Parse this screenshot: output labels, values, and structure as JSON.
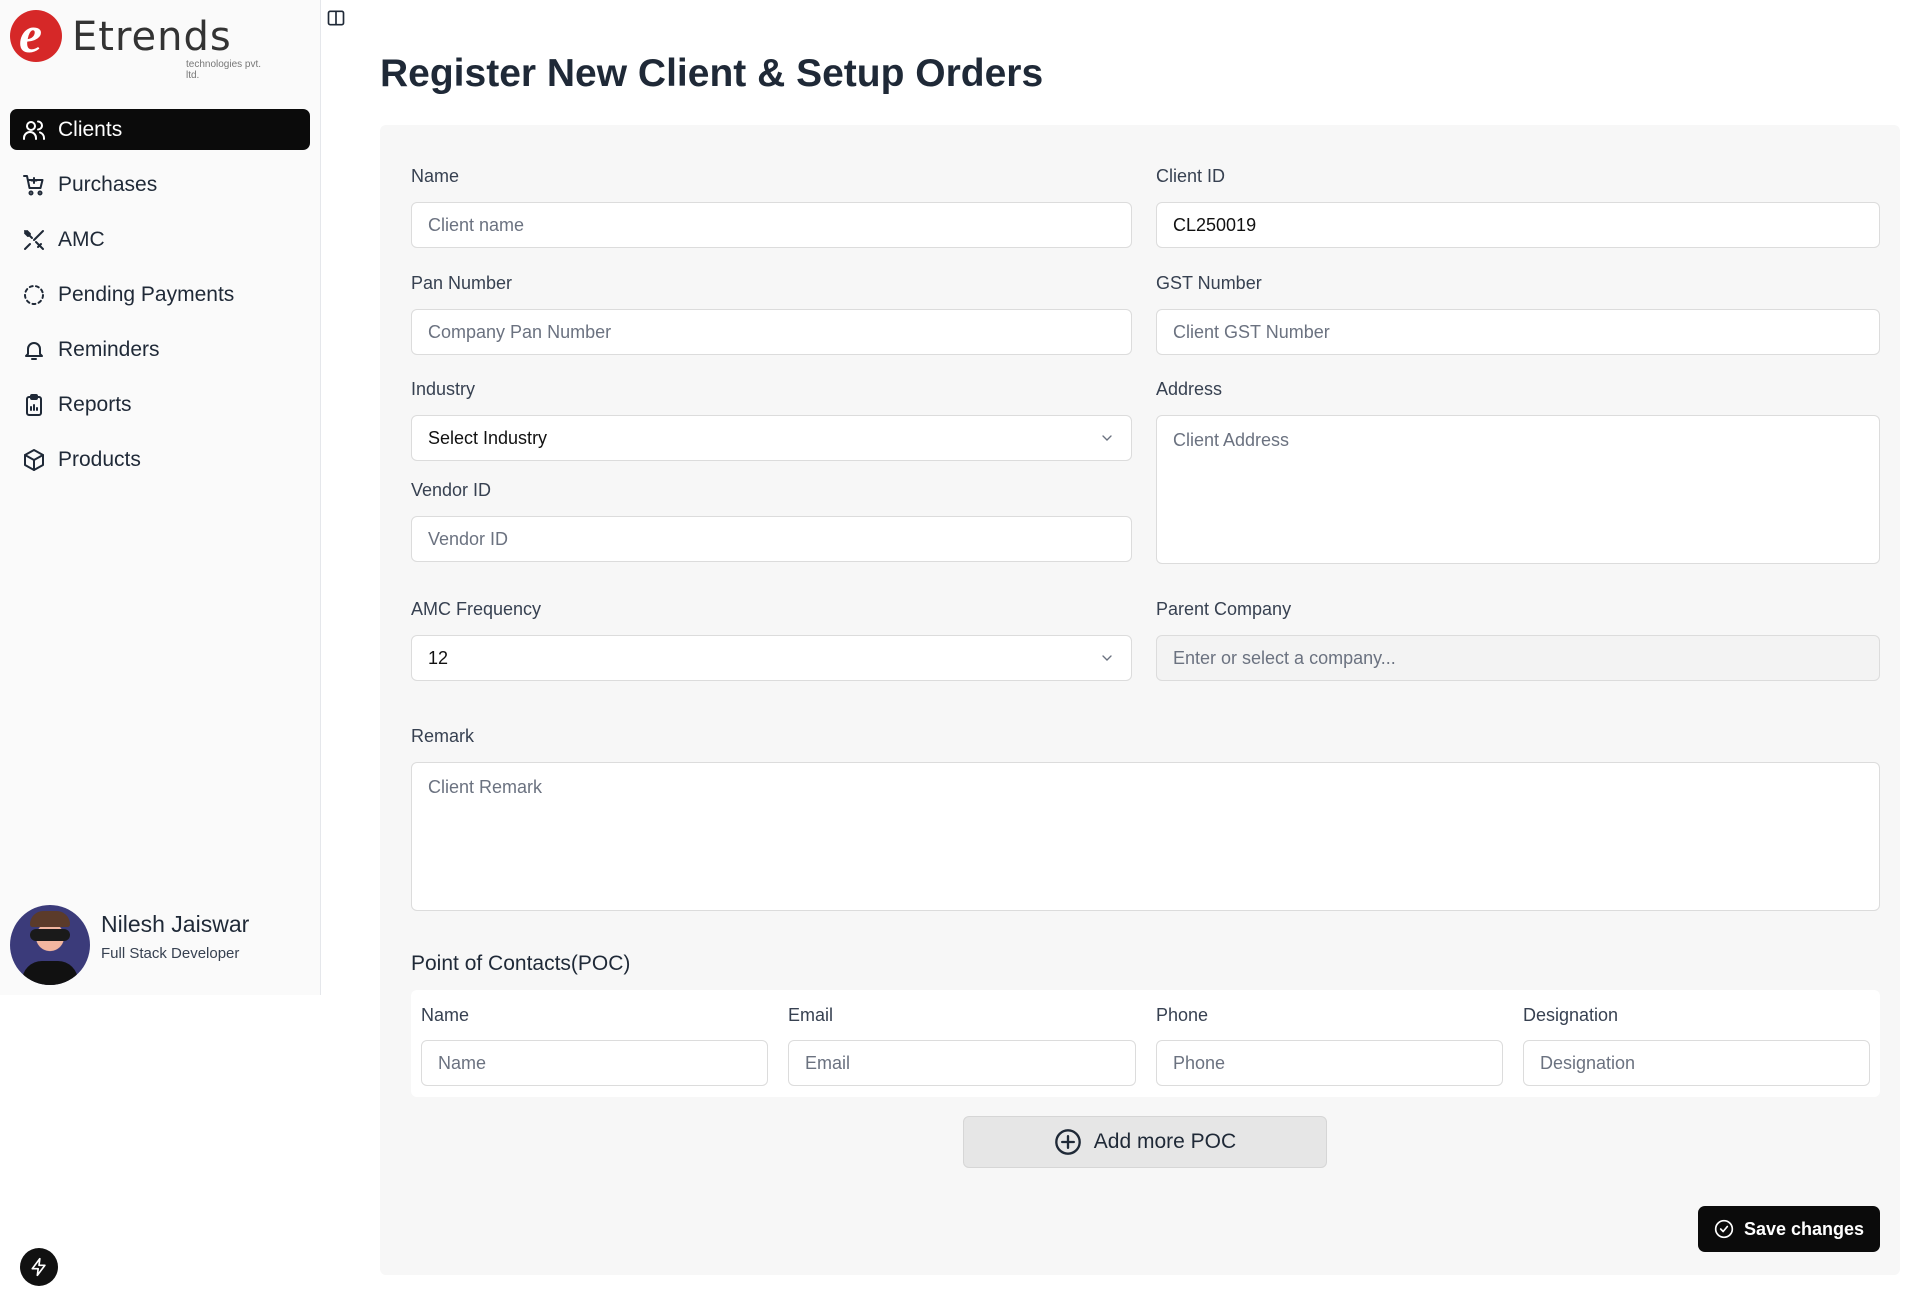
{
  "brand": {
    "mark": "e",
    "word": "Etrends",
    "sub": "technologies pvt. ltd."
  },
  "sidebar": {
    "items": [
      {
        "label": "Clients",
        "icon": "users-icon",
        "active": true
      },
      {
        "label": "Purchases",
        "icon": "cart-icon"
      },
      {
        "label": "AMC",
        "icon": "tools-icon"
      },
      {
        "label": "Pending Payments",
        "icon": "dashed-circle-icon"
      },
      {
        "label": "Reminders",
        "icon": "bell-icon"
      },
      {
        "label": "Reports",
        "icon": "clipboard-icon"
      },
      {
        "label": "Products",
        "icon": "box-icon"
      }
    ]
  },
  "user": {
    "name": "Nilesh Jaiswar",
    "role": "Full Stack Developer"
  },
  "page": {
    "title": "Register New Client & Setup Orders"
  },
  "form": {
    "name": {
      "label": "Name",
      "placeholder": "Client name",
      "value": ""
    },
    "client_id": {
      "label": "Client ID",
      "value": "CL250019"
    },
    "pan": {
      "label": "Pan Number",
      "placeholder": "Company Pan Number"
    },
    "gst": {
      "label": "GST Number",
      "placeholder": "Client GST Number"
    },
    "industry": {
      "label": "Industry",
      "value": "Select Industry"
    },
    "address": {
      "label": "Address",
      "placeholder": "Client Address"
    },
    "vendor": {
      "label": "Vendor ID",
      "placeholder": "Vendor ID"
    },
    "amc": {
      "label": "AMC Frequency",
      "value": "12"
    },
    "parent": {
      "label": "Parent Company",
      "placeholder": "Enter or select a company..."
    },
    "remark": {
      "label": "Remark",
      "placeholder": "Client Remark"
    }
  },
  "poc": {
    "title": "Point of Contacts(POC)",
    "name": {
      "label": "Name",
      "placeholder": "Name"
    },
    "email": {
      "label": "Email",
      "placeholder": "Email"
    },
    "phone": {
      "label": "Phone",
      "placeholder": "Phone"
    },
    "designation": {
      "label": "Designation",
      "placeholder": "Designation"
    },
    "add_label": "Add more POC"
  },
  "actions": {
    "save_label": "Save changes"
  }
}
